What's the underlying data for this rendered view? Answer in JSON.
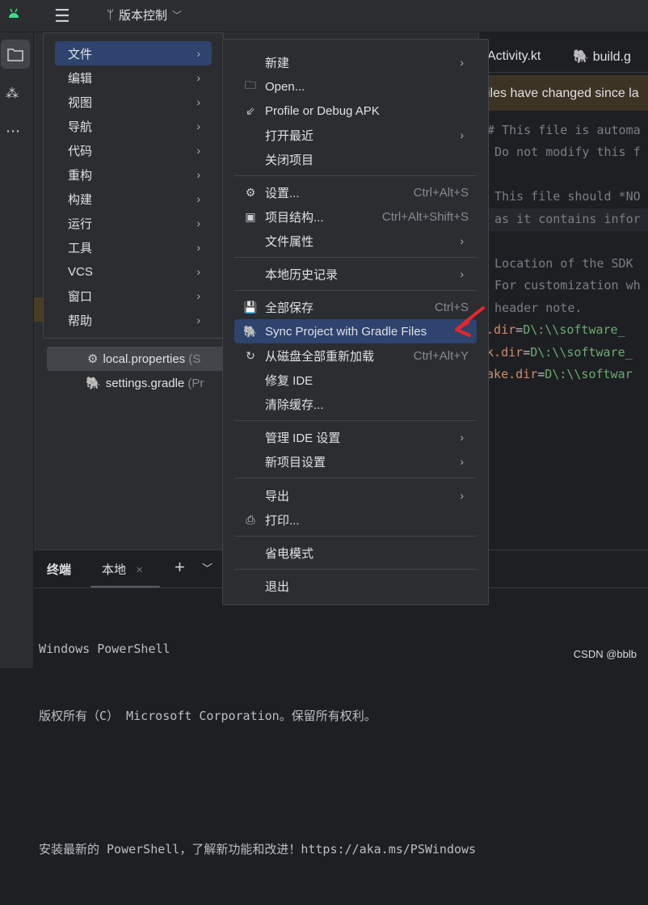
{
  "topbar": {
    "vcs_label": "版本控制"
  },
  "editor": {
    "tabs": [
      "Activity.kt",
      "build.g"
    ],
    "banner": "iles have changed since la",
    "lines": [
      {
        "t": "# This file is automa",
        "c": "comment"
      },
      {
        "t": " Do not modify this f",
        "c": "comment"
      },
      {
        "t": " This file should *NO",
        "c": "comment"
      },
      {
        "t": " as it contains infor",
        "c": "comment"
      },
      {
        "t": " Location of the SDK",
        "c": "comment"
      },
      {
        "t": " For customization wh",
        "c": "comment"
      },
      {
        "t": " header note.",
        "c": "comment"
      }
    ],
    "props": [
      {
        "k": "k.dir",
        "v": "D\\:\\\\software_"
      },
      {
        "k": "dk.dir",
        "v": "D\\:\\\\software_"
      },
      {
        "k": "make.dir",
        "v": "D\\:\\\\softwar"
      }
    ]
  },
  "project": {
    "files": [
      {
        "name": "local.properties",
        "suffix": "(S"
      },
      {
        "name": "settings.gradle",
        "suffix": "(Pr"
      }
    ]
  },
  "main_menu": [
    "文件",
    "编辑",
    "视图",
    "导航",
    "代码",
    "重构",
    "构建",
    "运行",
    "工具",
    "VCS",
    "窗口",
    "帮助"
  ],
  "file_menu": {
    "items": [
      {
        "label": "新建",
        "sub": true
      },
      {
        "label": "Open...",
        "icon": "folder-icon"
      },
      {
        "label": "Profile or Debug APK",
        "icon": "profile-apk-icon"
      },
      {
        "label": "打开最近",
        "sub": true
      },
      {
        "label": "关闭项目"
      },
      {
        "label": "设置...",
        "icon": "gear-icon",
        "shortcut": "Ctrl+Alt+S"
      },
      {
        "label": "项目结构...",
        "icon": "project-structure-icon",
        "shortcut": "Ctrl+Alt+Shift+S"
      },
      {
        "label": "文件属性",
        "sub": true
      },
      {
        "label": "本地历史记录",
        "sub": true
      },
      {
        "label": "全部保存",
        "icon": "save-icon",
        "shortcut": "Ctrl+S"
      },
      {
        "label": "Sync Project with Gradle Files",
        "icon": "gradle-sync-icon"
      },
      {
        "label": "从磁盘全部重新加载",
        "icon": "reload-icon",
        "shortcut": "Ctrl+Alt+Y"
      },
      {
        "label": "修复 IDE"
      },
      {
        "label": "清除缓存..."
      },
      {
        "label": "管理 IDE 设置",
        "sub": true
      },
      {
        "label": "新项目设置",
        "sub": true
      },
      {
        "label": "导出",
        "sub": true
      },
      {
        "label": "打印...",
        "icon": "print-icon"
      },
      {
        "label": "省电模式"
      },
      {
        "label": "退出"
      }
    ]
  },
  "terminal": {
    "title": "终端",
    "tab": "本地",
    "lines": [
      "Windows PowerShell",
      "版权所有（C） Microsoft Corporation。保留所有权利。",
      "",
      "安装最新的 PowerShell，了解新功能和改进！https://aka.ms/PSWindows"
    ]
  },
  "watermark": "CSDN @bblb",
  "colors": {
    "accent": "#2e436e",
    "annotation_arrow": "#e8252b",
    "banner": "#3d3324"
  }
}
